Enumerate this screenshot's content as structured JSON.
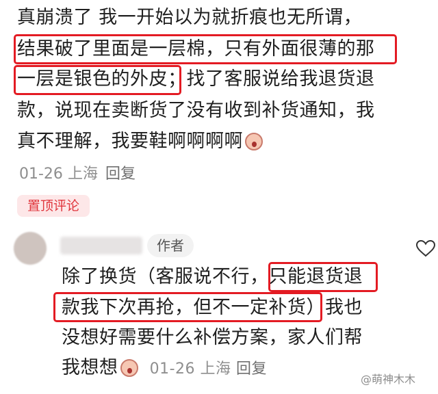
{
  "comment1": {
    "lines": [
      "真崩溃了 我一开始以为就折痕也无所谓，",
      "结果破了里面是一层棉，只有外面很薄的那",
      "一层是银色的外皮；找了客服说给我退货退",
      "款，说现在卖断货了没有收到补货通知，我",
      "真不理解，我要鞋啊啊啊啊"
    ],
    "date": "01-26",
    "location": "上海",
    "reply": "回复",
    "pinned_badge": "置顶评论"
  },
  "reply": {
    "author_badge": "作者",
    "lines": [
      "除了换货（客服说不行，只能退货退",
      "款我下次再抢，但不一定补货）我也",
      "没想好需要什么补偿方案，家人们帮",
      "我想想"
    ],
    "date": "01-26",
    "location": "上海",
    "reply": "回复"
  },
  "icons": {
    "emoji": "crying-face-icon",
    "like": "heart-icon",
    "avatar": "avatar"
  },
  "watermark": "@萌神木木",
  "colors": {
    "highlight": "#e31b23",
    "pin_bg": "#fde7e8",
    "pin_text": "#e0353c",
    "meta": "#8e8e8e"
  }
}
